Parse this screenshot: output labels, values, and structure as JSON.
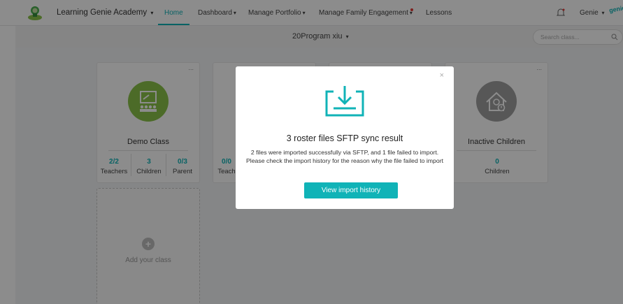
{
  "nav": {
    "org": "Learning Genie Academy",
    "home": "Home",
    "dashboard": "Dashboard",
    "portfolio": "Manage Portfolio",
    "family": "Manage Family Engagement",
    "lessons": "Lessons",
    "user": "Genie",
    "caret": "▾",
    "brand_mini": "genie"
  },
  "program": {
    "title": "20Program xiu",
    "caret": "▾"
  },
  "search": {
    "placeholder": "Search class..."
  },
  "cards": {
    "demo": {
      "more": "...",
      "title": "Demo Class",
      "stats": [
        {
          "value": "2/2",
          "label": "Teachers"
        },
        {
          "value": "3",
          "label": "Children"
        },
        {
          "value": "0/3",
          "label": "Parent"
        }
      ]
    },
    "second": {
      "stats": [
        {
          "value": "0/0",
          "label": "Teach"
        }
      ]
    },
    "inactive": {
      "more": "...",
      "title": "Inactive Children",
      "stats": [
        {
          "value": "0",
          "label": "Children"
        }
      ]
    },
    "add": {
      "label": "Add your class",
      "icon": "+"
    }
  },
  "modal": {
    "close": "×",
    "title": "3  roster files SFTP sync result",
    "message": "2 files were imported successfully via SFTP, and 1 file failed to import. Please check the import history for the reason why the file failed to import",
    "button": "View import history"
  },
  "colors": {
    "accent": "#10b3b7",
    "demo_green": "#8bc34a",
    "inactive_grey": "#9e9e9e"
  }
}
